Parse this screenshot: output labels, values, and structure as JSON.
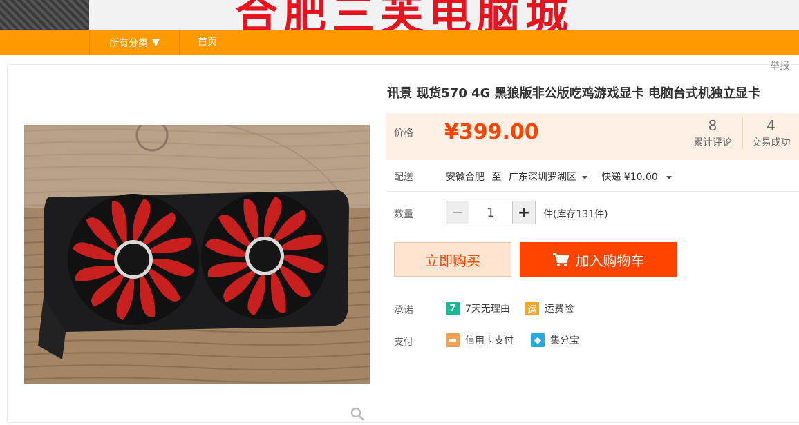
{
  "banner": {
    "shop_name": "合肥三芙电脑城"
  },
  "nav": {
    "category_label": "所有分类",
    "category_arrow": "▼",
    "home_label": "首页"
  },
  "report_label": "举报",
  "product": {
    "title": "讯景 现货570 4G 黑狼版非公版吃鸡游戏显卡 电脑台式机独立显卡",
    "price_label": "价格",
    "price": "¥399.00",
    "reviews_count": "8",
    "reviews_label": "累计评论",
    "sales_count": "4",
    "sales_label": "交易成功"
  },
  "shipping": {
    "label": "配送",
    "from": "安徽合肥",
    "to_word": "至",
    "destination": "广东深圳罗湖区",
    "method": "快递 ¥10.00"
  },
  "quantity": {
    "label": "数量",
    "minus": "−",
    "value": "1",
    "plus": "+",
    "stock_text": "件(库存131件)"
  },
  "actions": {
    "buy_now": "立即购买",
    "add_to_cart": "加入购物车"
  },
  "promise": {
    "label": "承诺",
    "items": [
      {
        "icon_text": "7",
        "text": "7天无理由"
      },
      {
        "icon_text": "运",
        "text": "运费险"
      }
    ]
  },
  "payment": {
    "label": "支付",
    "items": [
      {
        "icon_text": "▬",
        "text": "信用卡支付"
      },
      {
        "icon_text": "◆",
        "text": "集分宝"
      }
    ]
  },
  "colors": {
    "nav": "#ff9900",
    "price": "#ff4400",
    "cart_button": "#ff4400"
  }
}
